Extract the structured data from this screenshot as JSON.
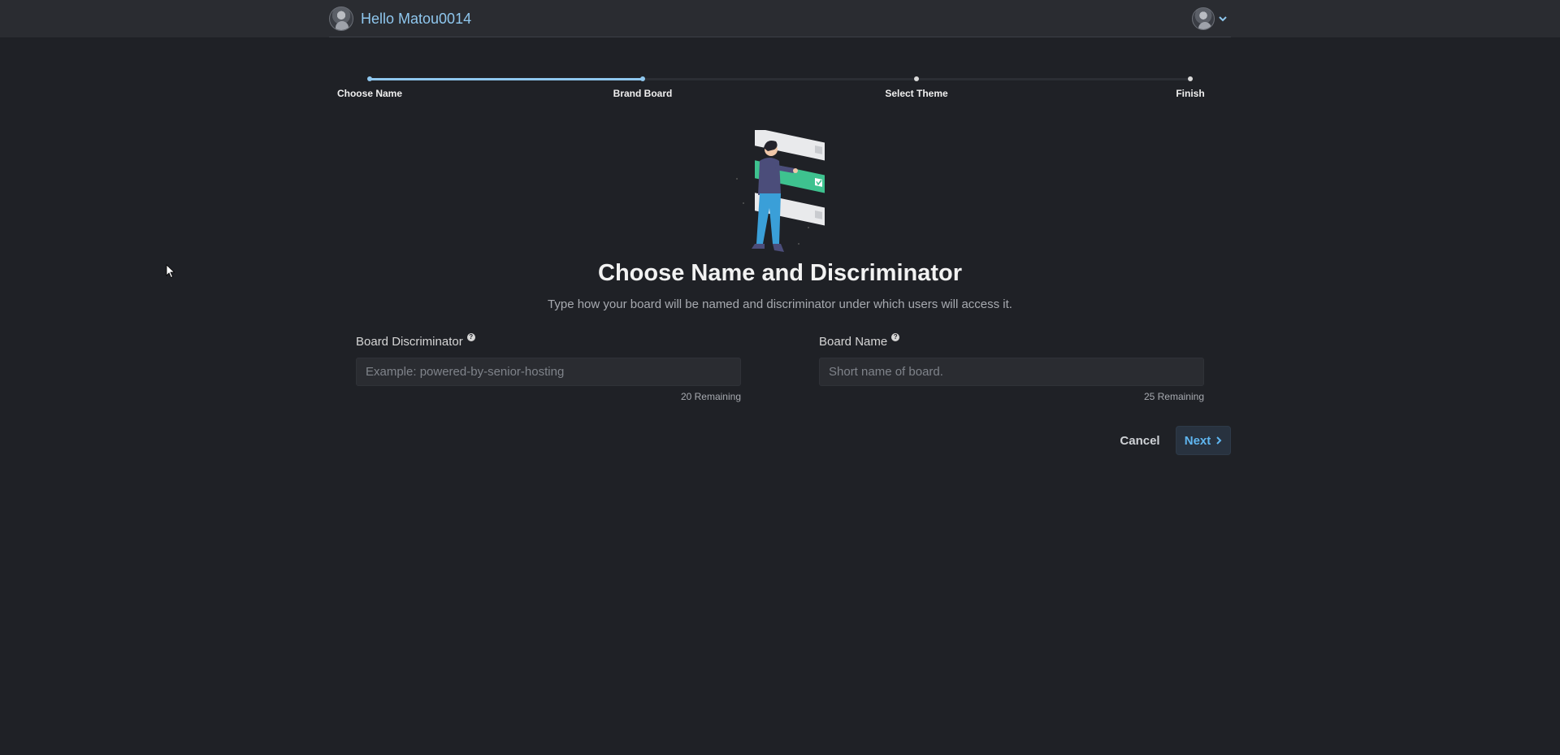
{
  "header": {
    "greeting": "Hello Matou0014",
    "avatar_icon": "user-avatar-icon",
    "menu_icon": "chevron-down-icon",
    "accent_color": "#8fc7ee"
  },
  "stepper": {
    "steps": [
      {
        "label": "Choose Name"
      },
      {
        "label": "Brand Board"
      },
      {
        "label": "Select Theme"
      },
      {
        "label": "Finish"
      }
    ],
    "progress_fraction": 0.333
  },
  "main": {
    "illustration": "person-with-checklist-illustration",
    "title": "Choose Name and Discriminator",
    "subtitle": "Type how your board will be named and discriminator under which users will access it.",
    "fields": [
      {
        "label": "Board Discriminator",
        "help_icon": "question-circle-icon",
        "placeholder": "Example: powered-by-senior-hosting",
        "value": "",
        "remaining": "20 Remaining"
      },
      {
        "label": "Board Name",
        "help_icon": "question-circle-icon",
        "placeholder": "Short name of board.",
        "value": "",
        "remaining": "25 Remaining"
      }
    ]
  },
  "actions": {
    "cancel_label": "Cancel",
    "next_label": "Next",
    "next_icon": "chevron-right-icon"
  }
}
